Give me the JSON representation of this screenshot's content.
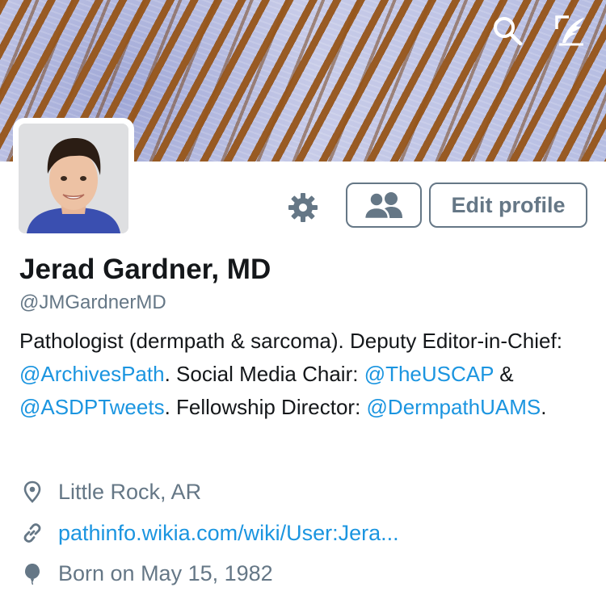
{
  "header": {
    "search_icon": "search-icon",
    "compose_icon": "compose-tweet-icon"
  },
  "actions": {
    "gear_icon": "gear-icon",
    "follow_icon": "people-icon",
    "edit_label": "Edit profile"
  },
  "profile": {
    "name": "Jerad Gardner, MD",
    "handle": "@JMGardnerMD",
    "bio": [
      {
        "text": "Pathologist (dermpath & sarcoma). Deputy Editor-in-Chief: ",
        "link": false
      },
      {
        "text": "@ArchivesPath",
        "link": true
      },
      {
        "text": ". Social Media Chair: ",
        "link": false
      },
      {
        "text": "@TheUSCAP",
        "link": true
      },
      {
        "text": " & ",
        "link": false
      },
      {
        "text": "@ASDPTweets",
        "link": true
      },
      {
        "text": ". Fellowship Director: ",
        "link": false
      },
      {
        "text": "@DermpathUAMS",
        "link": true
      },
      {
        "text": ".",
        "link": false
      }
    ],
    "location": "Little Rock, AR",
    "website": "pathinfo.wikia.com/wiki/User:Jera...",
    "birthday": "Born on May 15, 1982"
  },
  "colors": {
    "link": "#1b95e0",
    "secondary_text": "#657786",
    "primary_text": "#14171a"
  }
}
